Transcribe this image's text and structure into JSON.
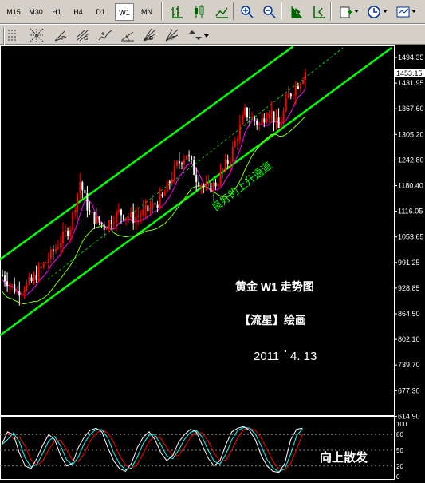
{
  "toolbar": {
    "timeframes": [
      "M15",
      "M30",
      "H1",
      "H4",
      "D1",
      "W1",
      "MN"
    ],
    "active_timeframe": "W1",
    "icons_row1": [
      "bar-chart-icon",
      "candlestick-icon",
      "line-chart-icon",
      "zoom-in-icon",
      "zoom-out-icon",
      "chart-shift-icon",
      "autoscroll-icon",
      "new-order-icon",
      "clock-icon",
      "templates-icon"
    ],
    "icons_row2": [
      "vertical-line-icon",
      "grid-icon",
      "gann-icon",
      "pitchfork-icon",
      "crosshair-icon",
      "trendline-icon",
      "fan-icon",
      "fibonacci-icon",
      "arrows-icon"
    ],
    "row2_letters": [
      "F",
      "G",
      "D",
      "F"
    ]
  },
  "chart": {
    "price_axis": [
      "1494.35",
      "1431.95",
      "1367.60",
      "1305.20",
      "1242.80",
      "1180.40",
      "1116.05",
      "1053.65",
      "991.25",
      "928.85",
      "864.50",
      "802.10",
      "739.70",
      "677.30",
      "614.90"
    ],
    "current_price": "1453.15",
    "annotation_channel": "良好的上升通道",
    "annotation_title": "黄金 W1 走势图",
    "annotation_author": "【流星】绘画",
    "annotation_date_main": "2011",
    "annotation_date_dot": ".",
    "annotation_date_rest": "4. 13",
    "colors": {
      "background": "#000000",
      "bull_candle": "#ff0000",
      "bear_candle": "#ffffff",
      "channel": "#00ff00",
      "ma_fast": "#ff00ff",
      "ma_slow": "#7cfc00"
    }
  },
  "indicator": {
    "levels": [
      "100",
      "80",
      "50",
      "20",
      "0"
    ],
    "annotation": "向上散发",
    "colors": {
      "main": "#ffffff",
      "signal": "#00ffff",
      "signal2": "#ff0000"
    }
  }
}
